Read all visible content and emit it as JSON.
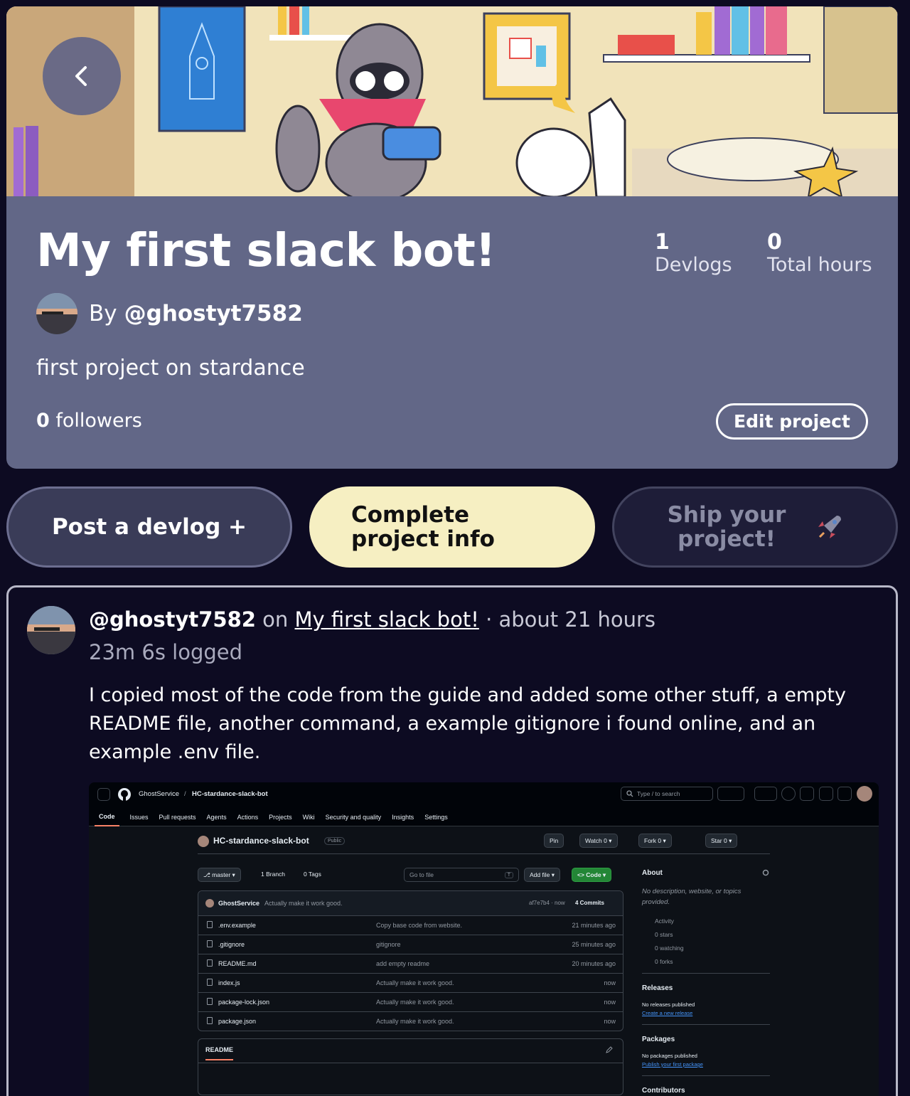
{
  "header": {
    "back_icon": "chevron-left-icon"
  },
  "project": {
    "title": "My first slack bot!",
    "by_prefix": "By",
    "author_handle": "@ghostyt7582",
    "description": "first project on stardance",
    "followers_count": "0",
    "followers_label": "followers",
    "edit_label": "Edit project",
    "stats": [
      {
        "value": "1",
        "label": "Devlogs"
      },
      {
        "value": "0",
        "label": "Total hours"
      }
    ]
  },
  "actions": {
    "post_devlog": "Post a devlog +",
    "complete_info": "Complete project info",
    "ship": "Ship your project!",
    "ship_icon": "rocket-icon"
  },
  "devlog": {
    "author": "@ghostyt7582",
    "on": "on",
    "project_link": "My first slack bot!",
    "age": "· about 21 hours",
    "logged": "23m 6s logged",
    "body": "I copied most of the code from the guide and added some other stuff, a empty README file, another command, a example gitignore i found online, and an example .env file."
  },
  "github": {
    "owner": "GhostService",
    "sep": "/",
    "repo": "HC-stardance-slack-bot",
    "search_placeholder": "Type / to search",
    "tabs": [
      "Code",
      "Issues",
      "Pull requests",
      "Agents",
      "Actions",
      "Projects",
      "Wiki",
      "Security and quality",
      "Insights",
      "Settings"
    ],
    "visibility": "Public",
    "pin": "Pin",
    "watch": "Watch",
    "watch_count": "0",
    "fork": "Fork",
    "fork_count": "0",
    "star": "Star",
    "star_count": "0",
    "branch": "master",
    "branches": "1 Branch",
    "tags": "0 Tags",
    "go_to_file": "Go to file",
    "go_to_file_key": "T",
    "add_file": "Add file",
    "code_btn": "Code",
    "last_commit": {
      "author": "GhostService",
      "message": "Actually make it work good.",
      "hash": "af7e7b4 · now",
      "commits": "4 Commits"
    },
    "files": [
      {
        "name": ".env.example",
        "message": "Copy base code from website.",
        "time": "21 minutes ago"
      },
      {
        "name": ".gitignore",
        "message": "gitignore",
        "time": "25 minutes ago"
      },
      {
        "name": "README.md",
        "message": "add empty readme",
        "time": "20 minutes ago"
      },
      {
        "name": "index.js",
        "message": "Actually make it work good.",
        "time": "now"
      },
      {
        "name": "package-lock.json",
        "message": "Actually make it work good.",
        "time": "now"
      },
      {
        "name": "package.json",
        "message": "Actually make it work good.",
        "time": "now"
      }
    ],
    "readme_tab": "README",
    "about": {
      "title": "About",
      "description": "No description, website, or topics provided.",
      "activity": "Activity",
      "stars": "0 stars",
      "watching": "0 watching",
      "forks": "0 forks"
    },
    "releases": {
      "title": "Releases",
      "none": "No releases published",
      "link": "Create a new release"
    },
    "packages": {
      "title": "Packages",
      "none": "No packages published",
      "link": "Publish your first package"
    },
    "contributors": {
      "title": "Contributors"
    }
  }
}
